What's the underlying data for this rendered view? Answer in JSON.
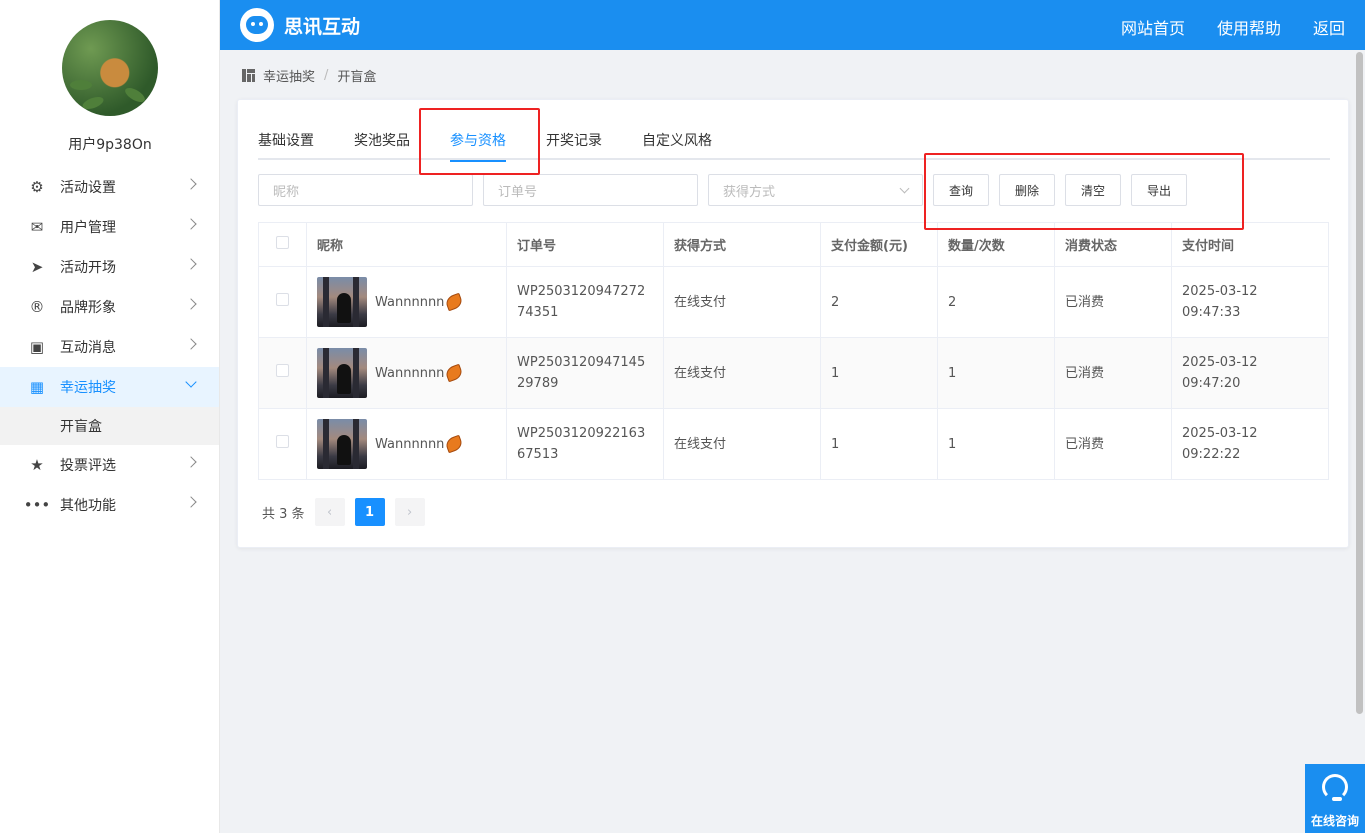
{
  "user": {
    "name": "用户9p38On"
  },
  "menu": [
    {
      "label": "活动设置",
      "icon": "gear-icon"
    },
    {
      "label": "用户管理",
      "icon": "user-icon"
    },
    {
      "label": "活动开场",
      "icon": "paper-plane-icon"
    },
    {
      "label": "品牌形象",
      "icon": "registered-icon"
    },
    {
      "label": "互动消息",
      "icon": "chat-bubble-icon"
    },
    {
      "label": "幸运抽奖",
      "icon": "lottery-icon",
      "active": true,
      "sub": [
        "开盲盒"
      ]
    },
    {
      "label": "投票评选",
      "icon": "star-icon"
    },
    {
      "label": "其他功能",
      "icon": "more-dots-icon"
    }
  ],
  "header": {
    "brand": "思讯互动",
    "links": [
      "网站首页",
      "使用帮助",
      "返回"
    ]
  },
  "breadcrumb": {
    "parent": "幸运抽奖",
    "sep": "/",
    "current": "开盲盒"
  },
  "tabs": [
    "基础设置",
    "奖池奖品",
    "参与资格",
    "开奖记录",
    "自定义风格"
  ],
  "active_tab": "参与资格",
  "filters": {
    "nickname_placeholder": "昵称",
    "order_placeholder": "订单号",
    "method_placeholder": "获得方式",
    "buttons": {
      "query": "查询",
      "delete": "删除",
      "clear": "清空",
      "export": "导出"
    }
  },
  "table": {
    "columns": [
      "昵称",
      "订单号",
      "获得方式",
      "支付金额(元)",
      "数量/次数",
      "消费状态",
      "支付时间"
    ],
    "rows": [
      {
        "nickname": "Wannnnnn",
        "order": "WP250312094727274351",
        "method": "在线支付",
        "amount": "2",
        "count": "2",
        "status": "已消费",
        "time": "2025-03-12 09:47:33"
      },
      {
        "nickname": "Wannnnnn",
        "order": "WP250312094714529789",
        "method": "在线支付",
        "amount": "1",
        "count": "1",
        "status": "已消费",
        "time": "2025-03-12 09:47:20"
      },
      {
        "nickname": "Wannnnnn",
        "order": "WP250312092216367513",
        "method": "在线支付",
        "amount": "1",
        "count": "1",
        "status": "已消费",
        "time": "2025-03-12 09:22:22"
      }
    ]
  },
  "pager": {
    "total": "共 3 条",
    "prev": "‹",
    "page": "1",
    "next": "›"
  },
  "consult": {
    "label": "在线咨询"
  },
  "colors": {
    "primary": "#1a8ef0",
    "accent": "#1890ff",
    "highlight_box": "#ee2222"
  }
}
